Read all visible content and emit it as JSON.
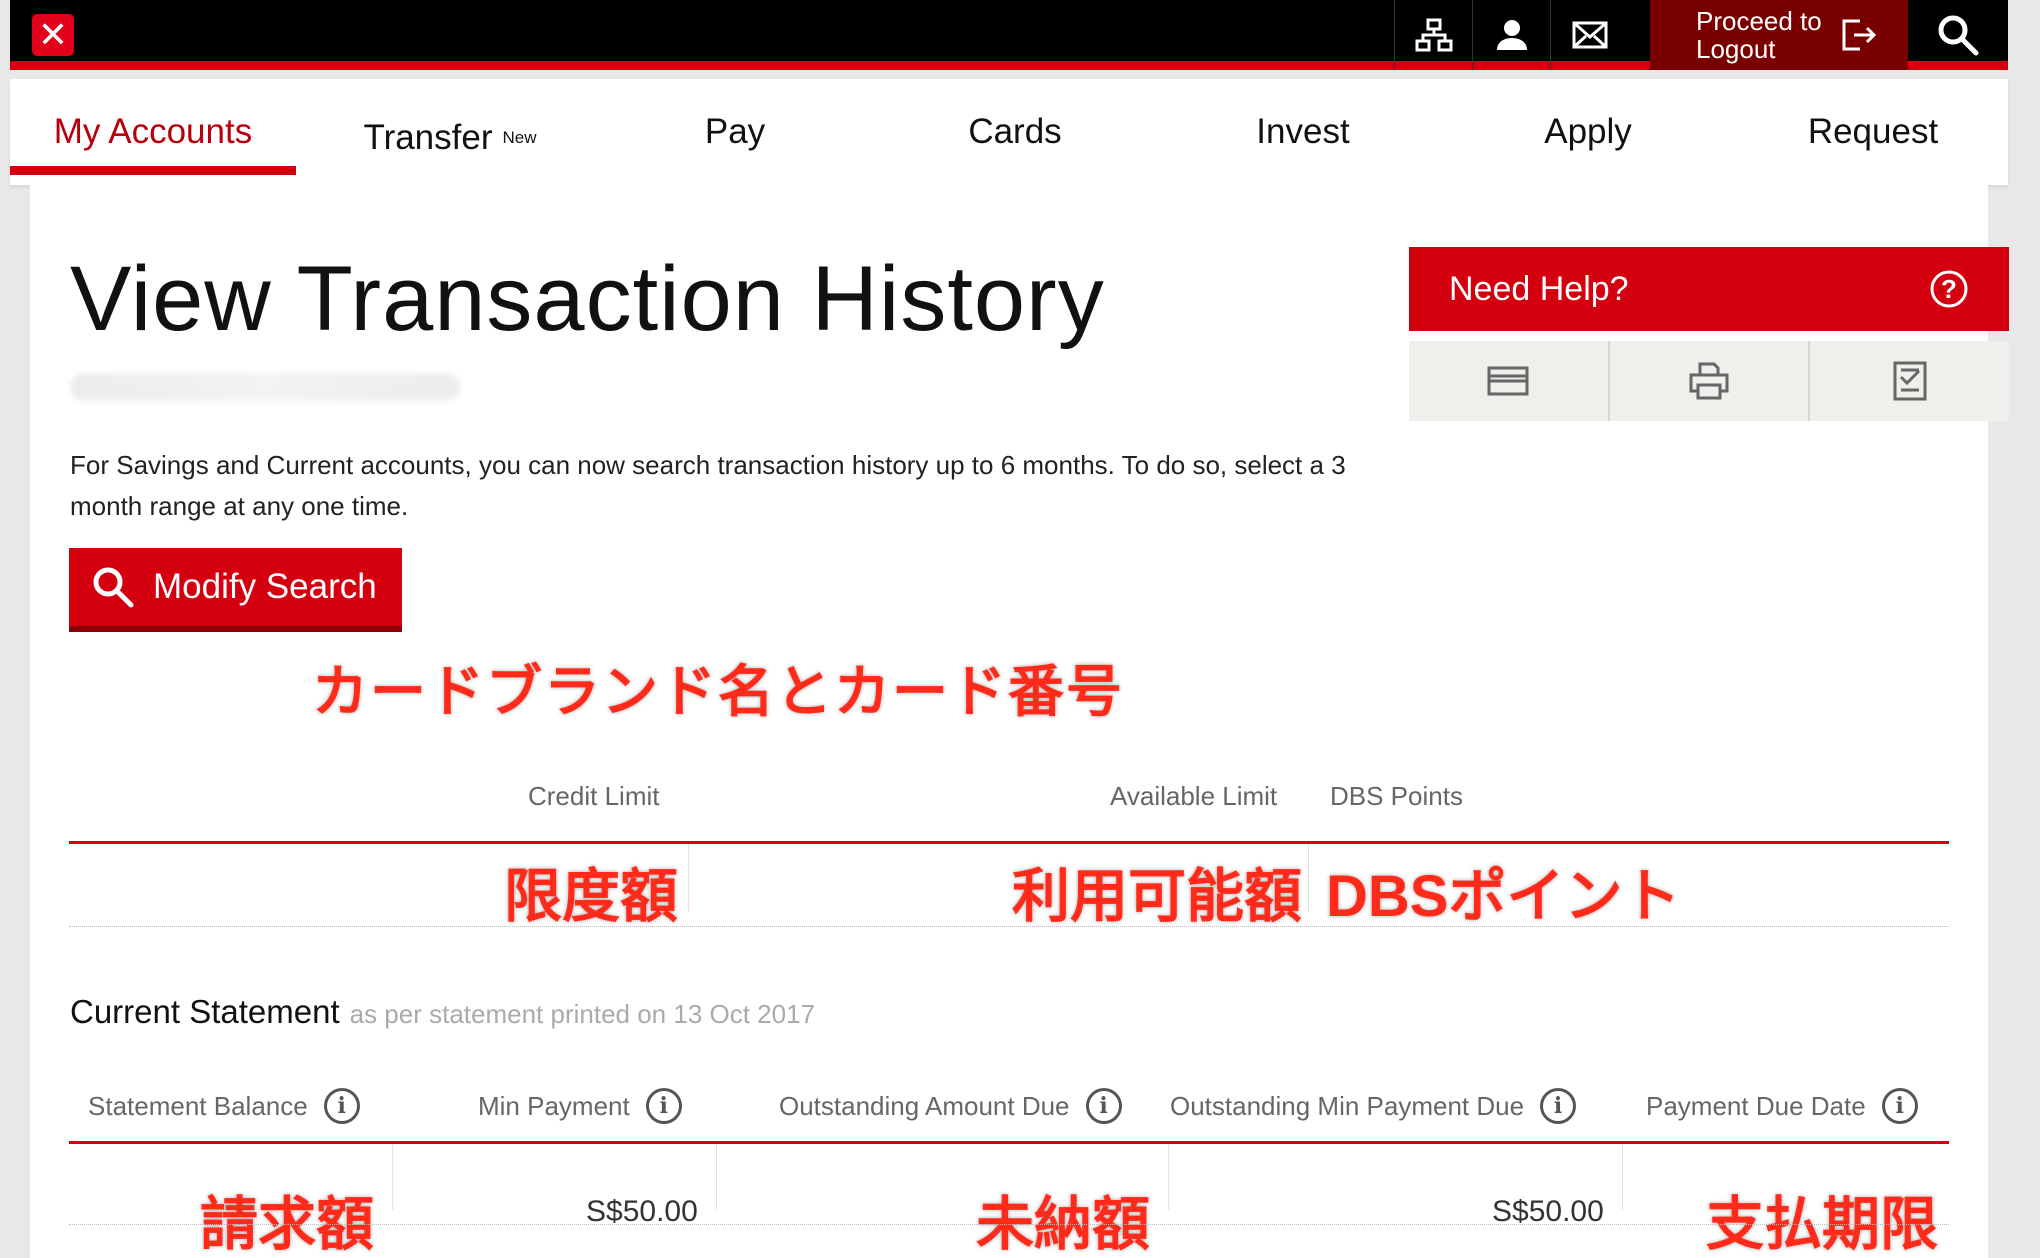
{
  "topbar": {
    "logo_symbol": "✕",
    "logout_label": "Proceed to Logout",
    "icons": [
      "sitemap-icon",
      "user-icon",
      "mail-icon",
      "logout-icon",
      "search-icon"
    ]
  },
  "nav": {
    "items": [
      {
        "label": "My Accounts",
        "active": true
      },
      {
        "label": "Transfer",
        "badge": "New"
      },
      {
        "label": "Pay"
      },
      {
        "label": "Cards"
      },
      {
        "label": "Invest"
      },
      {
        "label": "Apply"
      },
      {
        "label": "Request"
      }
    ]
  },
  "page": {
    "title": "View Transaction History",
    "intro": "For Savings and Current accounts, you can now search transaction history up to 6 months. To do so, select a 3 month range at any one time.",
    "modify_search": "Modify Search"
  },
  "help": {
    "title": "Need Help?",
    "tools": [
      "card-icon",
      "print-icon",
      "checklist-icon"
    ]
  },
  "card": {
    "brand_annotation": "カードブランド名とカード番号"
  },
  "summary": {
    "headers": {
      "credit_limit": "Credit Limit",
      "available_limit": "Available Limit",
      "dbs_points": "DBS Points"
    },
    "values": {
      "credit_limit": "限度額",
      "available_limit": "利用可能額",
      "dbs_points": "DBSポイント"
    }
  },
  "statement": {
    "title": "Current Statement",
    "subtitle": "as per statement printed on 13 Oct 2017",
    "headers": {
      "statement_balance": "Statement Balance",
      "min_payment": "Min Payment",
      "outstanding_amount_due": "Outstanding Amount Due",
      "outstanding_min_payment_due": "Outstanding Min Payment Due",
      "payment_due_date": "Payment Due Date"
    },
    "values": {
      "statement_balance": "請求額",
      "min_payment": "S$50.00",
      "outstanding_amount_due": "未納額",
      "outstanding_min_payment_due": "S$50.00",
      "payment_due_date": "支払期限"
    },
    "info_symbol": "i"
  },
  "colors": {
    "brand_red": "#d4000f",
    "dark_red": "#7a0000",
    "annotation_red": "#ff2a1a"
  }
}
